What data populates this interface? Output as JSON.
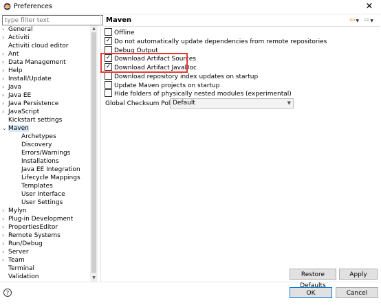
{
  "window": {
    "title": "Preferences",
    "close_symbol": "✕"
  },
  "filter": {
    "placeholder": "type filter text"
  },
  "tree": [
    {
      "label": "General",
      "expanded": false,
      "indent": 0
    },
    {
      "label": "Activiti",
      "expanded": false,
      "indent": 0
    },
    {
      "label": "Activiti cloud editor",
      "expanded": null,
      "indent": 0
    },
    {
      "label": "Ant",
      "expanded": false,
      "indent": 0
    },
    {
      "label": "Data Management",
      "expanded": false,
      "indent": 0
    },
    {
      "label": "Help",
      "expanded": false,
      "indent": 0
    },
    {
      "label": "Install/Update",
      "expanded": false,
      "indent": 0
    },
    {
      "label": "Java",
      "expanded": false,
      "indent": 0
    },
    {
      "label": "Java EE",
      "expanded": false,
      "indent": 0
    },
    {
      "label": "Java Persistence",
      "expanded": false,
      "indent": 0
    },
    {
      "label": "JavaScript",
      "expanded": false,
      "indent": 0
    },
    {
      "label": "Kickstart settings",
      "expanded": null,
      "indent": 0
    },
    {
      "label": "Maven",
      "expanded": true,
      "indent": 0,
      "selected": true
    },
    {
      "label": "Archetypes",
      "expanded": null,
      "indent": 1
    },
    {
      "label": "Discovery",
      "expanded": null,
      "indent": 1
    },
    {
      "label": "Errors/Warnings",
      "expanded": null,
      "indent": 1
    },
    {
      "label": "Installations",
      "expanded": null,
      "indent": 1
    },
    {
      "label": "Java EE Integration",
      "expanded": null,
      "indent": 1
    },
    {
      "label": "Lifecycle Mappings",
      "expanded": null,
      "indent": 1
    },
    {
      "label": "Templates",
      "expanded": null,
      "indent": 1
    },
    {
      "label": "User Interface",
      "expanded": null,
      "indent": 1
    },
    {
      "label": "User Settings",
      "expanded": null,
      "indent": 1
    },
    {
      "label": "Mylyn",
      "expanded": false,
      "indent": 0
    },
    {
      "label": "Plug-in Development",
      "expanded": false,
      "indent": 0
    },
    {
      "label": "PropertiesEditor",
      "expanded": false,
      "indent": 0
    },
    {
      "label": "Remote Systems",
      "expanded": false,
      "indent": 0
    },
    {
      "label": "Run/Debug",
      "expanded": false,
      "indent": 0
    },
    {
      "label": "Server",
      "expanded": false,
      "indent": 0
    },
    {
      "label": "Team",
      "expanded": false,
      "indent": 0
    },
    {
      "label": "Terminal",
      "expanded": null,
      "indent": 0
    },
    {
      "label": "Validation",
      "expanded": null,
      "indent": 0
    }
  ],
  "page": {
    "title": "Maven",
    "options": [
      {
        "label": "Offline",
        "checked": false
      },
      {
        "label": "Do not automatically update dependencies from remote repositories",
        "checked": true
      },
      {
        "label": "Debug Output",
        "checked": false
      },
      {
        "label": "Download Artifact Sources",
        "checked": true
      },
      {
        "label": "Download Artifact JavaDoc",
        "checked": true
      },
      {
        "label": "Download repository index updates on startup",
        "checked": false
      },
      {
        "label": "Update Maven projects on startup",
        "checked": false
      },
      {
        "label": "Hide folders of physically nested modules (experimental)",
        "checked": false
      }
    ],
    "checksum": {
      "label": "Global Checksum Policy:",
      "value": "Default"
    }
  },
  "buttons": {
    "restore_defaults": "Restore Defaults",
    "apply": "Apply",
    "ok": "OK",
    "cancel": "Cancel"
  },
  "colors": {
    "highlight": "#e53935",
    "selection": "#d9ebf9",
    "accent": "#0078d7"
  }
}
